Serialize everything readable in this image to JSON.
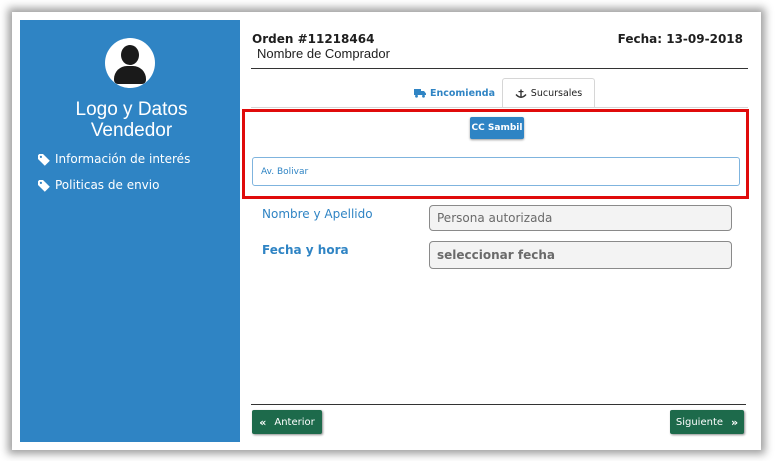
{
  "sidebar": {
    "logo_text": "Logo y Datos\nVendedor",
    "links": [
      {
        "label": "Información de interés",
        "icon": "tag-icon"
      },
      {
        "label": "Politicas de envio",
        "icon": "tag-icon"
      }
    ]
  },
  "header": {
    "order": "Orden #11218464",
    "buyer": "Nombre de Comprador",
    "date": "Fecha: 13-09-2018"
  },
  "tabs": [
    {
      "label": "Encomienda",
      "icon": "truck-icon",
      "active": false
    },
    {
      "label": "Sucursales",
      "icon": "anchor-icon",
      "active": true
    }
  ],
  "branch": {
    "button_label": "CC Sambil",
    "address_value": "Av. Bolivar"
  },
  "form": {
    "name_label": "Nombre y Apellido",
    "name_placeholder": "Persona autorizada",
    "date_label": "Fecha y hora",
    "date_placeholder": "seleccionar fecha"
  },
  "nav": {
    "prev_label": "Anterior",
    "next_label": "Siguiente"
  },
  "colors": {
    "sidebar": "#2f84c4",
    "accent": "#2f84c4",
    "nav_button": "#1d6a4b",
    "highlight": "#e00b0b"
  }
}
